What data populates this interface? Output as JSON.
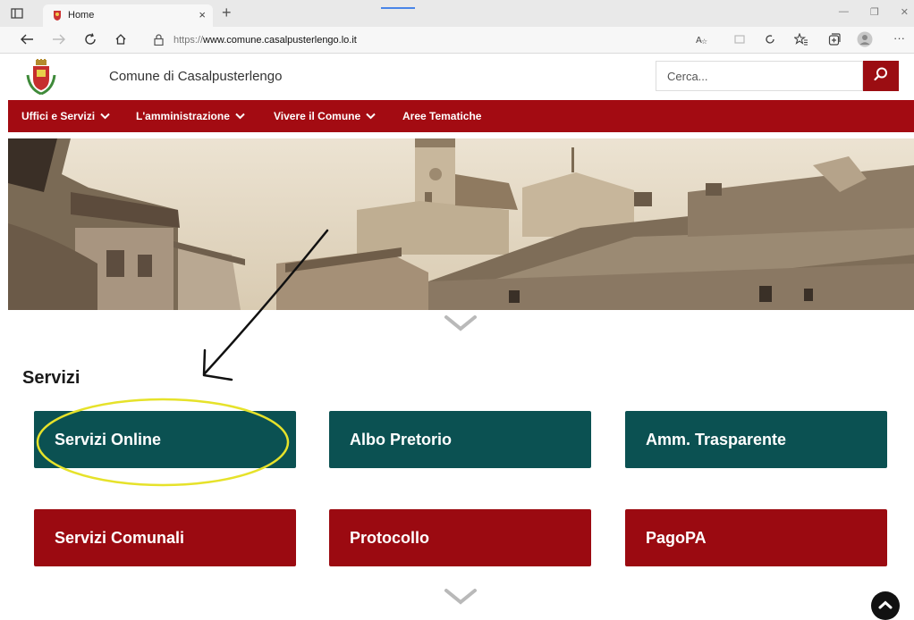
{
  "browser": {
    "tab_title": "Home",
    "url_prefix": "https://",
    "url_host": "www.comune.casalpusterlengo.lo.it"
  },
  "header": {
    "site_name": "Comune di Casalpusterlengo",
    "search_placeholder": "Cerca..."
  },
  "nav": {
    "items": [
      {
        "label": "Uffici e Servizi",
        "has_dropdown": true
      },
      {
        "label": "L'amministrazione",
        "has_dropdown": true
      },
      {
        "label": "Vivere il Comune",
        "has_dropdown": true
      },
      {
        "label": "Aree Tematiche",
        "has_dropdown": false
      }
    ]
  },
  "services": {
    "title": "Servizi",
    "tiles": [
      {
        "label": "Servizi Online",
        "color": "#0b5152"
      },
      {
        "label": "Albo Pretorio",
        "color": "#0b5152"
      },
      {
        "label": "Amm. Trasparente",
        "color": "#0b5152"
      },
      {
        "label": "Servizi Comunali",
        "color": "#9b0a11"
      },
      {
        "label": "Protocollo",
        "color": "#9b0a11"
      },
      {
        "label": "PagoPA",
        "color": "#9b0a11"
      }
    ]
  },
  "icons": {
    "search": "search-icon",
    "chevron": "chevron-down-icon",
    "back_to_top": "chevron-up-icon",
    "crest": "municipal-crest-icon"
  },
  "colors": {
    "brand_red": "#a30b12",
    "teal": "#0b5152",
    "annotation_highlight": "#e6e22a"
  }
}
